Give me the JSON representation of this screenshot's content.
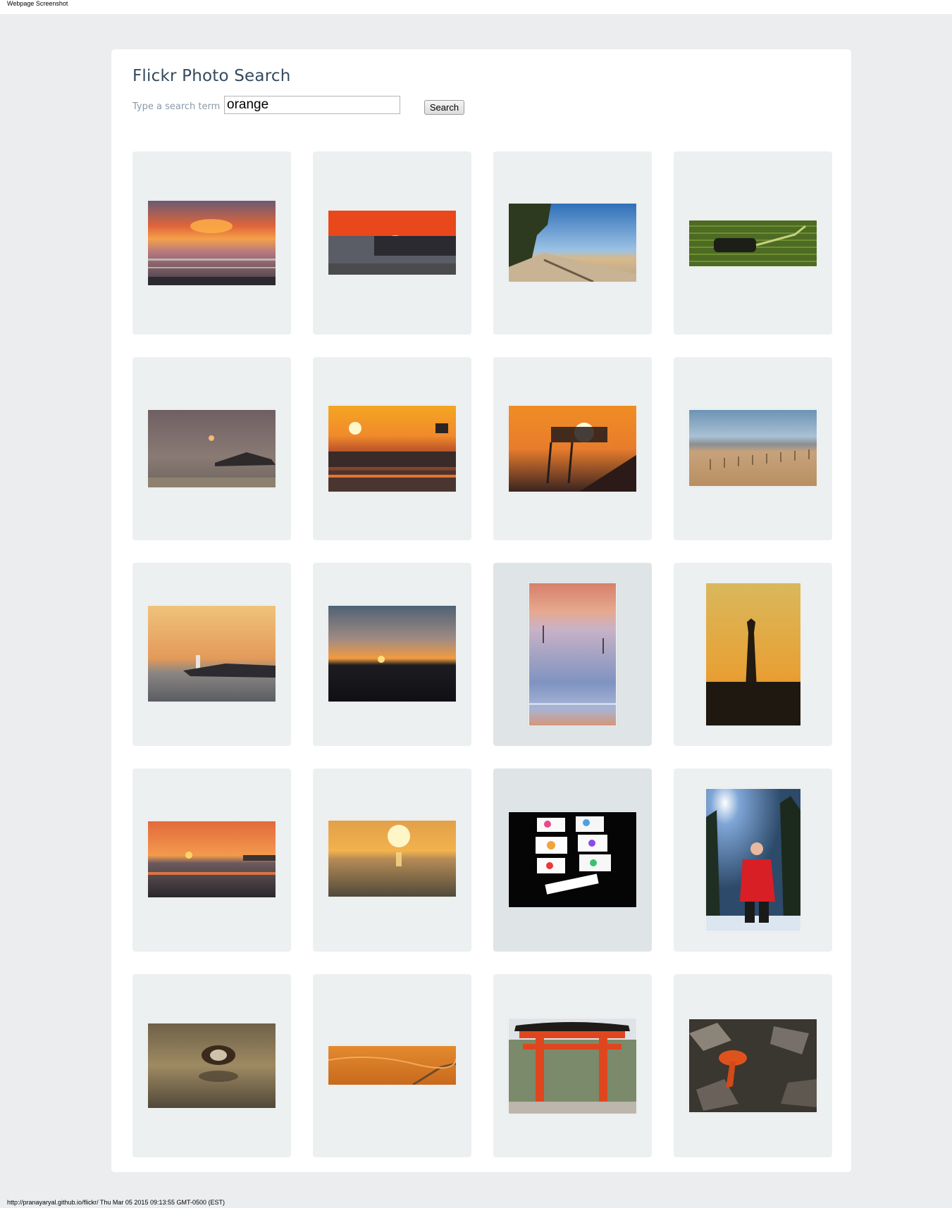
{
  "browser": {
    "title": "Webpage Screenshot"
  },
  "app": {
    "title": "Flickr Photo Search"
  },
  "search": {
    "label": "Type a search term",
    "value": "orange",
    "button_label": "Search"
  },
  "results": [
    {
      "name": "photo-sunset-sea-clouds"
    },
    {
      "name": "photo-red-sunset-pier"
    },
    {
      "name": "photo-pine-beach"
    },
    {
      "name": "photo-green-fabric-object"
    },
    {
      "name": "photo-hazy-sunrise-fishing-hut"
    },
    {
      "name": "photo-sun-fishing-hut"
    },
    {
      "name": "photo-sun-fishing-cabin"
    },
    {
      "name": "photo-beach-fence"
    },
    {
      "name": "photo-lighthouse-dusk"
    },
    {
      "name": "photo-sunset-horizon"
    },
    {
      "name": "photo-pastel-sea-buoy"
    },
    {
      "name": "photo-lighthouse-silhouette"
    },
    {
      "name": "photo-sunset-harbor"
    },
    {
      "name": "photo-golden-sun-beach"
    },
    {
      "name": "photo-colorful-cards"
    },
    {
      "name": "photo-man-red-jacket-forest"
    },
    {
      "name": "photo-duck-water"
    },
    {
      "name": "photo-orange-desert"
    },
    {
      "name": "photo-torii-gate"
    },
    {
      "name": "photo-orange-mushroom"
    }
  ],
  "footer": {
    "text": "http://pranayaryal.github.io/flickr/ Thu Mar 05 2015 09:13:55 GMT-0500 (EST)"
  }
}
